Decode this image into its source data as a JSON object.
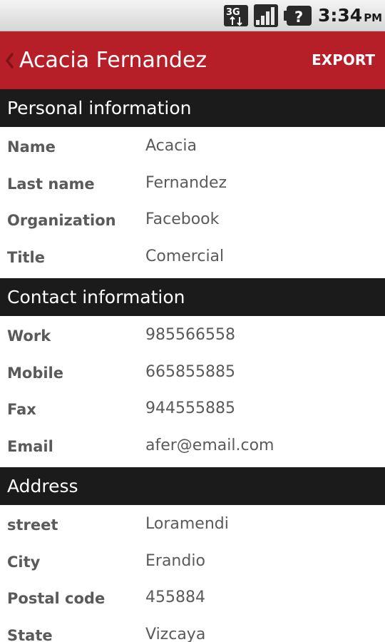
{
  "status_bar": {
    "network_icon": "3g-data-icon",
    "signal_icon": "signal-strength-icon",
    "battery_icon": "battery-unknown-icon",
    "battery_glyph": "?",
    "network_label": "3G",
    "time": "3:34",
    "ampm": "PM"
  },
  "header": {
    "back_icon": "chevron-left-icon",
    "title": "Acacia Fernandez",
    "export_label": "EXPORT",
    "color": "#b71f28"
  },
  "sections": {
    "personal": {
      "title": "Personal information",
      "fields": [
        {
          "label": "Name",
          "value": "Acacia"
        },
        {
          "label": "Last name",
          "value": "Fernandez"
        },
        {
          "label": "Organization",
          "value": "Facebook"
        },
        {
          "label": "Title",
          "value": "Comercial"
        }
      ]
    },
    "contact": {
      "title": "Contact information",
      "fields": [
        {
          "label": "Work",
          "value": "985566558"
        },
        {
          "label": "Mobile",
          "value": "665855885"
        },
        {
          "label": "Fax",
          "value": "944555885"
        },
        {
          "label": "Email",
          "value": "afer@email.com"
        }
      ]
    },
    "address": {
      "title": "Address",
      "fields": [
        {
          "label": "street",
          "value": "Loramendi"
        },
        {
          "label": "City",
          "value": "Erandio"
        },
        {
          "label": "Postal code",
          "value": "455884"
        },
        {
          "label": "State",
          "value": "Vizcaya"
        }
      ]
    }
  }
}
